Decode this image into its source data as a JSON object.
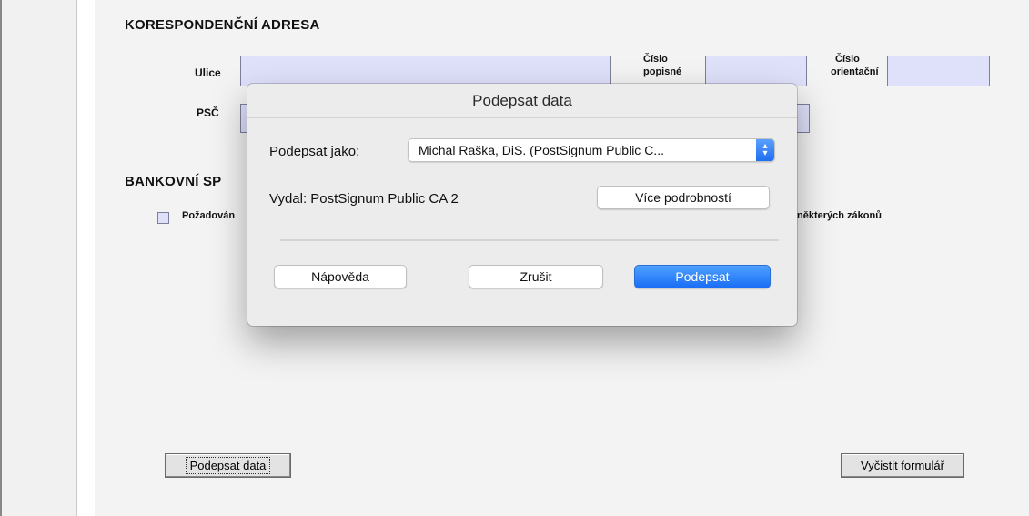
{
  "form": {
    "section_correspondence": "KORESPONDENČNÍ ADRESA",
    "label_street": "Ulice",
    "label_house_number_line1": "Číslo",
    "label_house_number_line2": "popisné",
    "label_orientation_number_line1": "Číslo",
    "label_orientation_number_line2": "orientační",
    "label_zip": "PSČ",
    "section_bank_partial": "BANKOVNÍ SP",
    "checkbox_label_partial": "Požadován",
    "checkbox_label_tail": "některých zákonů",
    "sign_button": "Podepsat data",
    "clear_button": "Vyčistit formulář"
  },
  "dialog": {
    "title": "Podepsat data",
    "sign_as_label": "Podepsat jako:",
    "sign_as_value": "Michal Raška, DiS. (PostSignum Public C...",
    "issuer_text": "Vydal: PostSignum Public CA 2",
    "details_button": "Více podrobností",
    "help_button": "Nápověda",
    "cancel_button": "Zrušit",
    "sign_button": "Podepsat"
  },
  "colors": {
    "field_fill": "#dfe1fb",
    "primary_button": "#1a6ef5"
  }
}
